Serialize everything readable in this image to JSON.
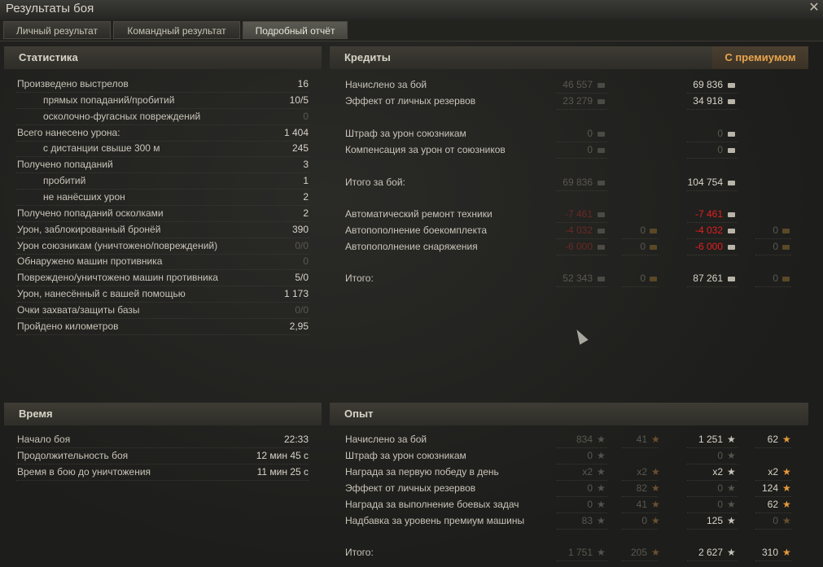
{
  "window": {
    "title": "Результаты боя",
    "close": "✕"
  },
  "tabs": [
    "Личный результат",
    "Командный результат",
    "Подробный отчёт"
  ],
  "stats": {
    "header": "Статистика",
    "rows": [
      {
        "label": "Произведено выстрелов",
        "value": "16"
      },
      {
        "label": "прямых попаданий/пробитий",
        "value": "10/5"
      },
      {
        "label": "осколочно-фугасных повреждений",
        "value": "0"
      },
      {
        "label": "Всего нанесено урона:",
        "value": "1 404"
      },
      {
        "label": "с дистанции свыше 300 м",
        "value": "245"
      },
      {
        "label": "Получено попаданий",
        "value": "3"
      },
      {
        "label": "пробитий",
        "value": "1"
      },
      {
        "label": "не нанёсших урон",
        "value": "2"
      },
      {
        "label": "Получено попаданий осколками",
        "value": "2"
      },
      {
        "label": "Урон, заблокированный бронёй",
        "value": "390"
      },
      {
        "label": "Урон союзникам (уничтожено/повреждений)",
        "value": "0/0"
      },
      {
        "label": "Обнаружено машин противника",
        "value": "0"
      },
      {
        "label": "Повреждено/уничтожено машин противника",
        "value": "5/0"
      },
      {
        "label": "Урон, нанесённый с вашей помощью",
        "value": "1 173"
      },
      {
        "label": "Очки захвата/защиты базы",
        "value": "0/0"
      },
      {
        "label": "Пройдено километров",
        "value": "2,95"
      }
    ]
  },
  "credits": {
    "header": "Кредиты",
    "premium_label": "С премиумом",
    "rows": [
      {
        "label": "Начислено за бой",
        "base": "46 557",
        "base_gold": "",
        "prem": "69 836",
        "prem_gold": ""
      },
      {
        "label": "Эффект от личных резервов",
        "base": "23 279",
        "base_gold": "",
        "prem": "34 918",
        "prem_gold": ""
      },
      {
        "label": "Штраф за урон союзникам",
        "base": "0",
        "base_gold": "",
        "prem": "0",
        "prem_gold": ""
      },
      {
        "label": "Компенсация за урон от союзников",
        "base": "0",
        "base_gold": "",
        "prem": "0",
        "prem_gold": ""
      },
      {
        "label": "Итого за бой:",
        "base": "69 836",
        "base_gold": "",
        "prem": "104 754",
        "prem_gold": ""
      },
      {
        "label": "Автоматический ремонт техники",
        "base": "-7 461",
        "base_gold": "",
        "prem": "-7 461",
        "prem_gold": ""
      },
      {
        "label": "Автопополнение боекомплекта",
        "base": "-4 032",
        "base_gold": "0",
        "prem": "-4 032",
        "prem_gold": "0"
      },
      {
        "label": "Автопополнение снаряжения",
        "base": "-6 000",
        "base_gold": "0",
        "prem": "-6 000",
        "prem_gold": "0"
      },
      {
        "label": "Итого:",
        "base": "52 343",
        "base_gold": "0",
        "prem": "87 261",
        "prem_gold": "0"
      }
    ]
  },
  "time": {
    "header": "Время",
    "rows": [
      {
        "label": "Начало боя",
        "value": "22:33"
      },
      {
        "label": "Продолжительность боя",
        "value": "12 мин 45 с"
      },
      {
        "label": "Время в бою до уничтожения",
        "value": "11 мин 25 с"
      }
    ]
  },
  "xp": {
    "header": "Опыт",
    "rows": [
      {
        "label": "Начислено за бой",
        "b1": "834",
        "b2": "41",
        "p1": "1 251",
        "p2": "62"
      },
      {
        "label": "Штраф за урон союзникам",
        "b1": "0",
        "b2": "",
        "p1": "0",
        "p2": ""
      },
      {
        "label": "Награда за первую победу в день",
        "b1": "x2",
        "b2": "x2",
        "p1": "x2",
        "p2": "x2"
      },
      {
        "label": "Эффект от личных резервов",
        "b1": "0",
        "b2": "82",
        "p1": "0",
        "p2": "124"
      },
      {
        "label": "Награда за выполнение боевых задач",
        "b1": "0",
        "b2": "41",
        "p1": "0",
        "p2": "62"
      },
      {
        "label": "Надбавка за уровень премиум машины",
        "b1": "83",
        "b2": "0",
        "p1": "125",
        "p2": "0"
      },
      {
        "label": "Итого:",
        "b1": "1 751",
        "b2": "205",
        "p1": "2 627",
        "p2": "310"
      }
    ]
  },
  "icons": {
    "credit": "credit-coin-icon",
    "gold": "gold-bar-icon",
    "xp": "star-icon",
    "free_xp": "orange-star-icon"
  },
  "colors": {
    "premium": "#e8a44e",
    "negative": "#e02020",
    "background": "#1c1c1a"
  }
}
